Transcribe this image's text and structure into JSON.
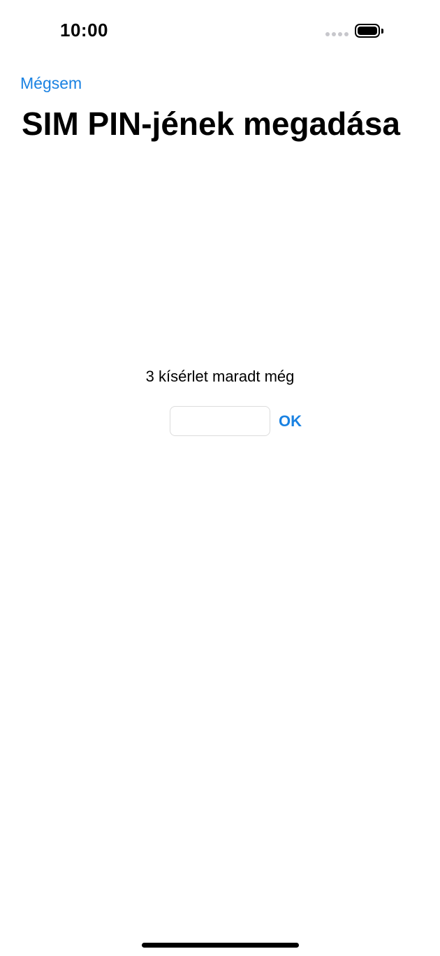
{
  "status_bar": {
    "time": "10:00",
    "signal_icon": "cellular-signal-icon",
    "battery_icon": "battery-full-icon",
    "battery_level": 1.0
  },
  "nav": {
    "cancel_label": "Mégsem"
  },
  "header": {
    "title": "SIM PIN-jének megadása"
  },
  "pin_entry": {
    "attempts_text": "3 kísérlet maradt még",
    "pin_value": "",
    "pin_placeholder": "",
    "ok_label": "OK"
  },
  "colors": {
    "accent": "#1a82e2",
    "text": "#000000",
    "background": "#ffffff"
  }
}
